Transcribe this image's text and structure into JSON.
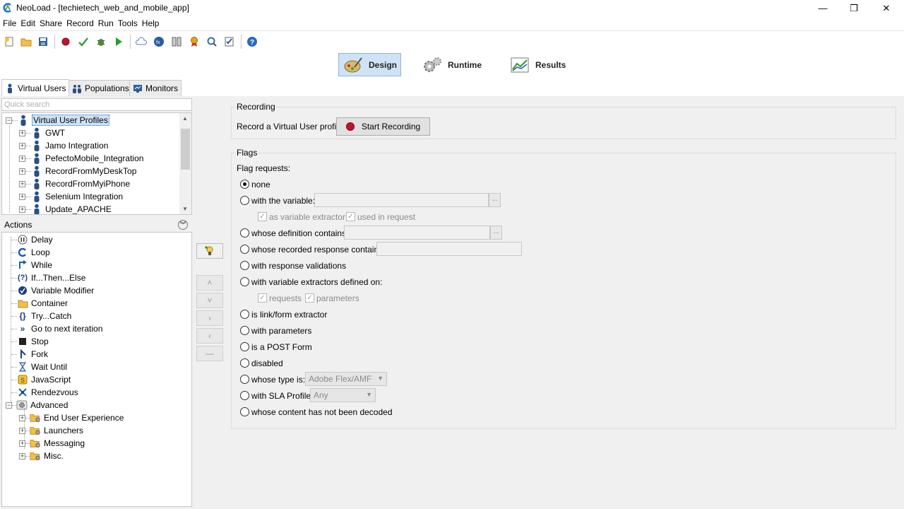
{
  "window": {
    "title": "NeoLoad - [techietech_web_and_mobile_app]",
    "minimize_glyph": "—",
    "restore_glyph": "❐",
    "close_glyph": "✕"
  },
  "menu": [
    "File",
    "Edit",
    "Share",
    "Record",
    "Run",
    "Tools",
    "Help"
  ],
  "modes": {
    "design": "Design",
    "runtime": "Runtime",
    "results": "Results"
  },
  "left_tabs": {
    "virtual_users": "Virtual Users",
    "populations": "Populations",
    "monitors": "Monitors"
  },
  "search": {
    "placeholder": "Quick search"
  },
  "profiles_tree": {
    "root": "Virtual User Profiles",
    "items": [
      "GWT",
      "Jamo Integration",
      "PefectoMobile_Integration",
      "RecordFromMyDeskTop",
      "RecordFromMyiPhone",
      "Selenium Integration",
      "Update_APACHE"
    ]
  },
  "actions": {
    "header": "Actions",
    "items": [
      "Delay",
      "Loop",
      "While",
      "If...Then...Else",
      "Variable Modifier",
      "Container",
      "Try...Catch",
      "Go to next iteration",
      "Stop",
      "Fork",
      "Wait Until",
      "JavaScript",
      "Rendezvous",
      "Advanced"
    ],
    "advanced_children": [
      "End User Experience",
      "Launchers",
      "Messaging",
      "Misc."
    ]
  },
  "mid_buttons": {
    "up": "˄",
    "down": "˅",
    "right": "›",
    "left": "‹",
    "remove": "—"
  },
  "recording": {
    "title": "Recording",
    "label": "Record a Virtual User profile",
    "button": "Start Recording"
  },
  "flags": {
    "title": "Flags",
    "subtitle": "Flag requests:",
    "ellipsis": "...",
    "check_mark": "✓",
    "options": {
      "none": "none",
      "with_variable": "with the variable:",
      "as_variable_extractor": "as variable extractor",
      "used_in_request": "used in request",
      "definition_contains": "whose definition contains:",
      "recorded_response_contains": "whose recorded response contains:",
      "response_validations": "with response validations",
      "variable_extractors_defined_on": "with variable extractors defined on:",
      "requests": "requests",
      "parameters": "parameters",
      "link_form_extractor": "is link/form extractor",
      "with_parameters": "with parameters",
      "post_form": "is a POST Form",
      "disabled": "disabled",
      "type_is": "whose type is:",
      "type_value": "Adobe Flex/AMF",
      "sla_profile": "with SLA Profile:",
      "sla_value": "Any",
      "not_decoded": "whose content has not been decoded"
    },
    "selected": "none"
  },
  "colors": {
    "accent": "#cfe3f6",
    "record": "#c8102e"
  }
}
